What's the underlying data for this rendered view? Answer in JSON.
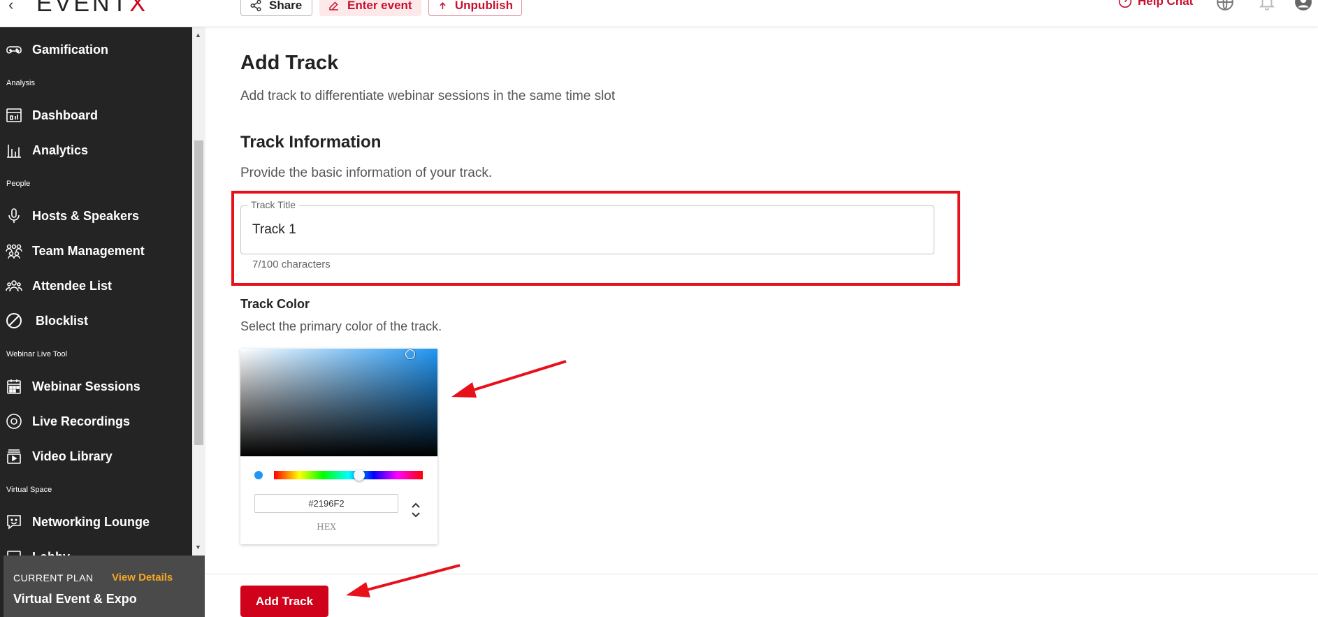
{
  "header": {
    "logo": "EVENTX",
    "share_label": "Share",
    "enter_event_label": "Enter event",
    "unpublish_label": "Unpublish",
    "help_chat_label": "Help Chat"
  },
  "sidebar": {
    "items": [
      {
        "label": "Gamification",
        "icon": "gamepad-icon"
      },
      {
        "section": "Analysis"
      },
      {
        "label": "Dashboard",
        "icon": "dashboard-icon"
      },
      {
        "label": "Analytics",
        "icon": "bar-chart-icon"
      },
      {
        "section": "People"
      },
      {
        "label": "Hosts & Speakers",
        "icon": "microphone-icon"
      },
      {
        "label": "Team Management",
        "icon": "team-icon"
      },
      {
        "label": "Attendee List",
        "icon": "people-icon"
      },
      {
        "label": "Blocklist",
        "icon": "block-icon"
      },
      {
        "section": "Webinar Live Tool"
      },
      {
        "label": "Webinar Sessions",
        "icon": "calendar-icon"
      },
      {
        "label": "Live Recordings",
        "icon": "record-icon"
      },
      {
        "label": "Video Library",
        "icon": "video-library-icon"
      },
      {
        "section": "Virtual Space"
      },
      {
        "label": "Networking Lounge",
        "icon": "chat-smile-icon"
      },
      {
        "label": "Lobby",
        "icon": "lobby-icon"
      }
    ],
    "plan": {
      "heading": "CURRENT PLAN",
      "link": "View Details",
      "name": "Virtual Event & Expo"
    }
  },
  "main": {
    "title": "Add Track",
    "subtitle": "Add track to differentiate webinar sessions in the same time slot",
    "section_title": "Track Information",
    "section_desc": "Provide the basic information of your track.",
    "track_title": {
      "label": "Track Title",
      "value": "Track 1",
      "helper": "7/100 characters"
    },
    "track_color": {
      "label": "Track Color",
      "desc": "Select the primary color of the track.",
      "hex_value": "#2196F2",
      "hex_label": "HEX"
    },
    "add_button": "Add Track"
  },
  "colors": {
    "brand_red": "#d0021b",
    "annotation_red": "#e8101a",
    "sidebar_bg": "#242424",
    "accent_orange": "#f5a623",
    "selected_color": "#2196F2"
  }
}
